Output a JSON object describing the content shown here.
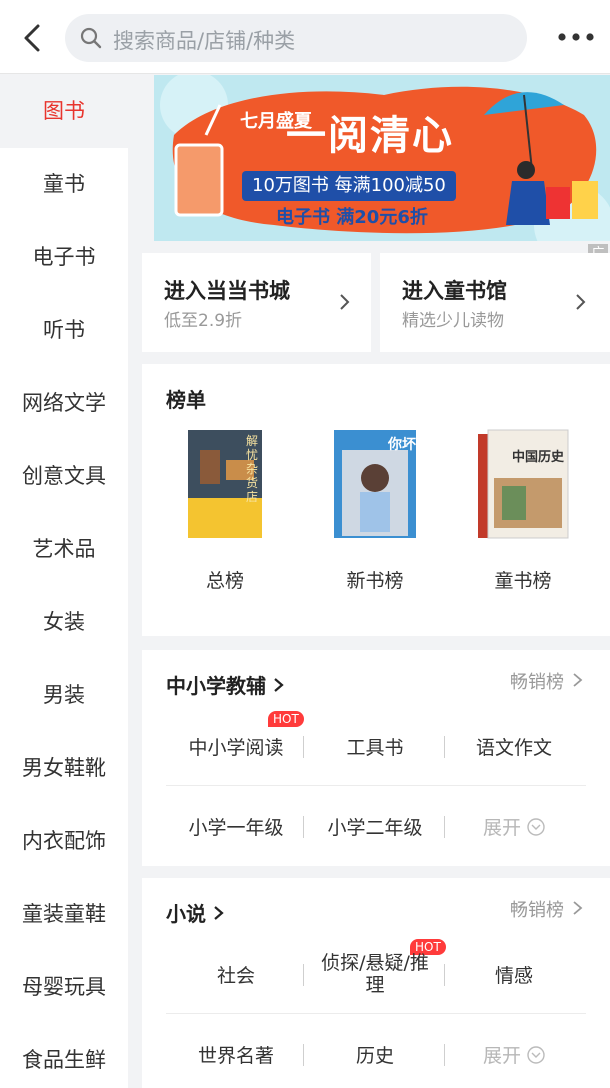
{
  "header": {
    "search_placeholder": "搜索商品/店铺/种类"
  },
  "sidebar": {
    "items": [
      "图书",
      "童书",
      "电子书",
      "听书",
      "网络文学",
      "创意文具",
      "艺术品",
      "女装",
      "男装",
      "男女鞋靴",
      "内衣配饰",
      "童装童鞋",
      "母婴玩具",
      "食品生鲜"
    ],
    "active_index": 0
  },
  "banner": {
    "headline_small": "七月盛夏",
    "headline_big": "一阅清心",
    "promo_1": "10万图书 每满100减50",
    "promo_2": "电子书 满20元6折",
    "ad_tag": "广告"
  },
  "entries": [
    {
      "title": "进入当当书城",
      "subtitle": "低至2.9折"
    },
    {
      "title": "进入童书馆",
      "subtitle": "精选少儿读物"
    }
  ],
  "rank": {
    "title": "榜单",
    "items": [
      {
        "label": "总榜",
        "cover_text": "解忧杂货店"
      },
      {
        "label": "新书榜",
        "cover_text": "你坏"
      },
      {
        "label": "童书榜",
        "cover_text": "中国历史"
      }
    ]
  },
  "k12": {
    "title": "中小学教辅",
    "more": "畅销榜",
    "hot_tag": "HOT",
    "row1": [
      "中小学阅读",
      "工具书",
      "语文作文"
    ],
    "row2": [
      "小学一年级",
      "小学二年级",
      "展开"
    ]
  },
  "novel": {
    "title": "小说",
    "more": "畅销榜",
    "hot_tag": "HOT",
    "row1": [
      "社会",
      "侦探/悬疑/推\n理",
      "情感"
    ],
    "row2": [
      "世界名著",
      "历史",
      "展开"
    ]
  },
  "colors": {
    "accent": "#e8342d",
    "banner_orange": "#f0592a",
    "banner_blue": "#1f4fa8"
  }
}
